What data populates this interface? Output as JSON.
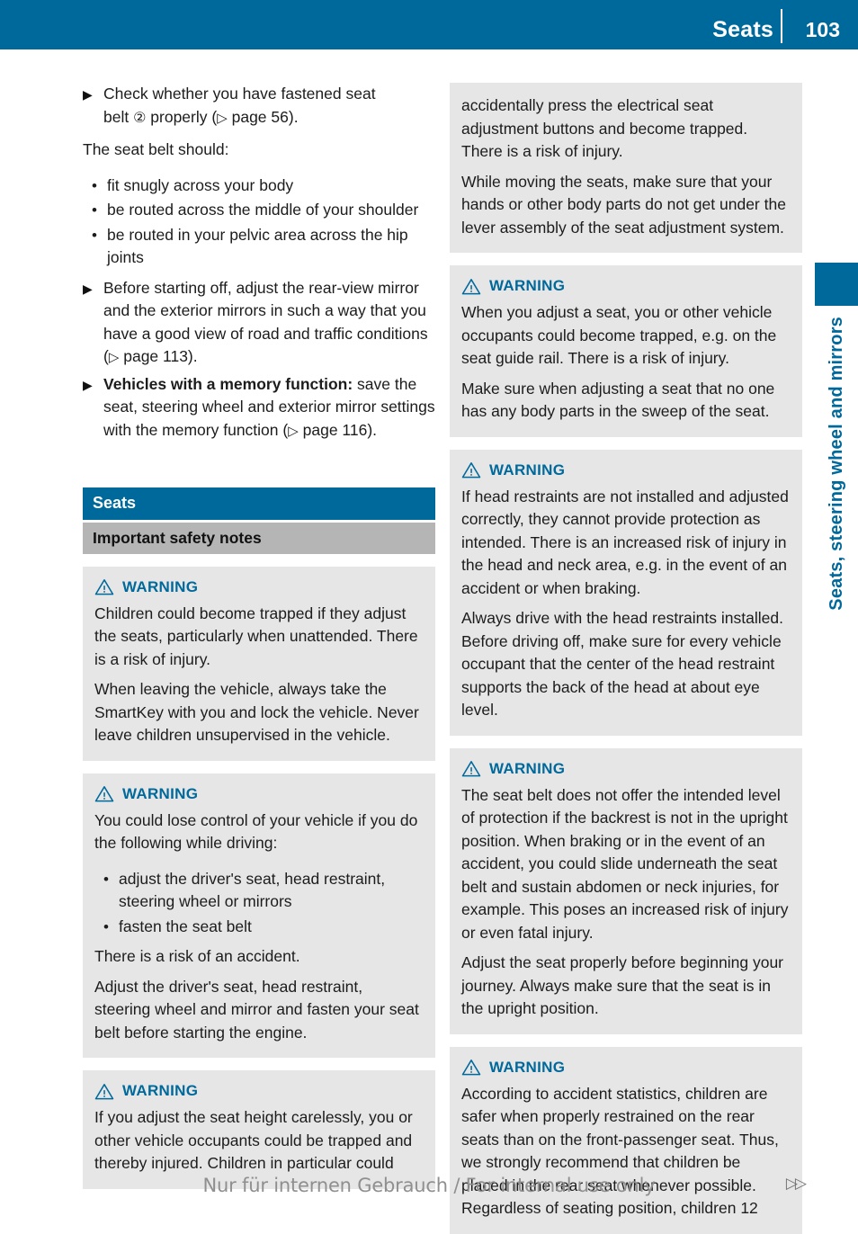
{
  "header": {
    "title": "Seats",
    "page_number": "103"
  },
  "thumb_tab": {
    "label": "Seats, steering wheel and mirrors",
    "color": "#00699c"
  },
  "colors": {
    "accent_blue": "#00699c",
    "note_background": "#e6e6e6",
    "subsection_background": "#b5b5b5",
    "text": "#1c1c1c"
  },
  "left_column": {
    "action_item_1": {
      "line1": "Check whether you have fastened seat",
      "line2_before": "belt ",
      "circled_number": "②",
      "line2_after": " properly (",
      "page_ref_glyph": "▷",
      "page_ref": " page 56)."
    },
    "intro_text": "The seat belt should:",
    "belt_bullets": [
      "fit snugly across your body",
      "be routed across the middle of your shoulder",
      "be routed in your pelvic area across the hip joints"
    ],
    "action_item_2": {
      "text_before": "Before starting off, adjust the rear-view mirror and the exterior mirrors in such a way that you have a good view of road and traffic conditions (",
      "page_ref_glyph": "▷",
      "text_after": " page 113)."
    },
    "action_item_3": {
      "bold_lead": "Vehicles with a memory function:",
      "text": " save the seat, steering wheel and exterior mirror settings with the memory function (",
      "page_ref_glyph": "▷",
      "text_after": " page 116)."
    },
    "section_heading": "Seats",
    "subsection_heading": "Important safety notes",
    "warnings": [
      {
        "label": "WARNING",
        "paragraphs": [
          "Children could become trapped if they adjust the seats, particularly when unattended. There is a risk of injury.",
          "When leaving the vehicle, always take the SmartKey with you and lock the vehicle. Never leave children unsupervised in the vehicle."
        ]
      },
      {
        "label": "WARNING",
        "intro": "You could lose control of your vehicle if you do the following while driving:",
        "bullets": [
          "adjust the driver's seat, head restraint, steering wheel or mirrors",
          "fasten the seat belt"
        ],
        "paragraphs": [
          "There is a risk of an accident.",
          "Adjust the driver's seat, head restraint, steering wheel and mirror and fasten your seat belt before starting the engine."
        ]
      },
      {
        "label": "WARNING",
        "paragraphs": [
          "If you adjust the seat height carelessly, you or other vehicle occupants could be trapped and thereby injured. Children in particular could"
        ]
      }
    ]
  },
  "right_column": {
    "continued_box": {
      "paragraphs": [
        "accidentally press the electrical seat adjustment buttons and become trapped. There is a risk of injury.",
        "While moving the seats, make sure that your hands or other body parts do not get under the lever assembly of the seat adjustment system."
      ]
    },
    "warnings": [
      {
        "label": "WARNING",
        "paragraphs": [
          "When you adjust a seat, you or other vehicle occupants could become trapped, e.g. on the seat guide rail. There is a risk of injury.",
          "Make sure when adjusting a seat that no one has any body parts in the sweep of the seat."
        ]
      },
      {
        "label": "WARNING",
        "paragraphs": [
          "If head restraints are not installed and adjusted correctly, they cannot provide protection as intended. There is an increased risk of injury in the head and neck area, e.g. in the event of an accident or when braking.",
          "Always drive with the head restraints installed. Before driving off, make sure for every vehicle occupant that the center of the head restraint supports the back of the head at about eye level."
        ]
      },
      {
        "label": "WARNING",
        "paragraphs": [
          "The seat belt does not offer the intended level of protection if the backrest is not in the upright position. When braking or in the event of an accident, you could slide underneath the seat belt and sustain abdomen or neck injuries, for example. This poses an increased risk of injury or even fatal injury.",
          "Adjust the seat properly before beginning your journey. Always make sure that the seat is in the upright position."
        ]
      },
      {
        "label": "WARNING",
        "paragraphs": [
          "According to accident statistics, children are safer when properly restrained on the rear seats than on the front-passenger seat. Thus, we strongly recommend that children be placed in the rear seat whenever possible. Regardless of seating position, children 12"
        ]
      }
    ]
  },
  "footer": {
    "text": "Nur für internen Gebrauch / For internal use only",
    "mark": "▷▷"
  }
}
